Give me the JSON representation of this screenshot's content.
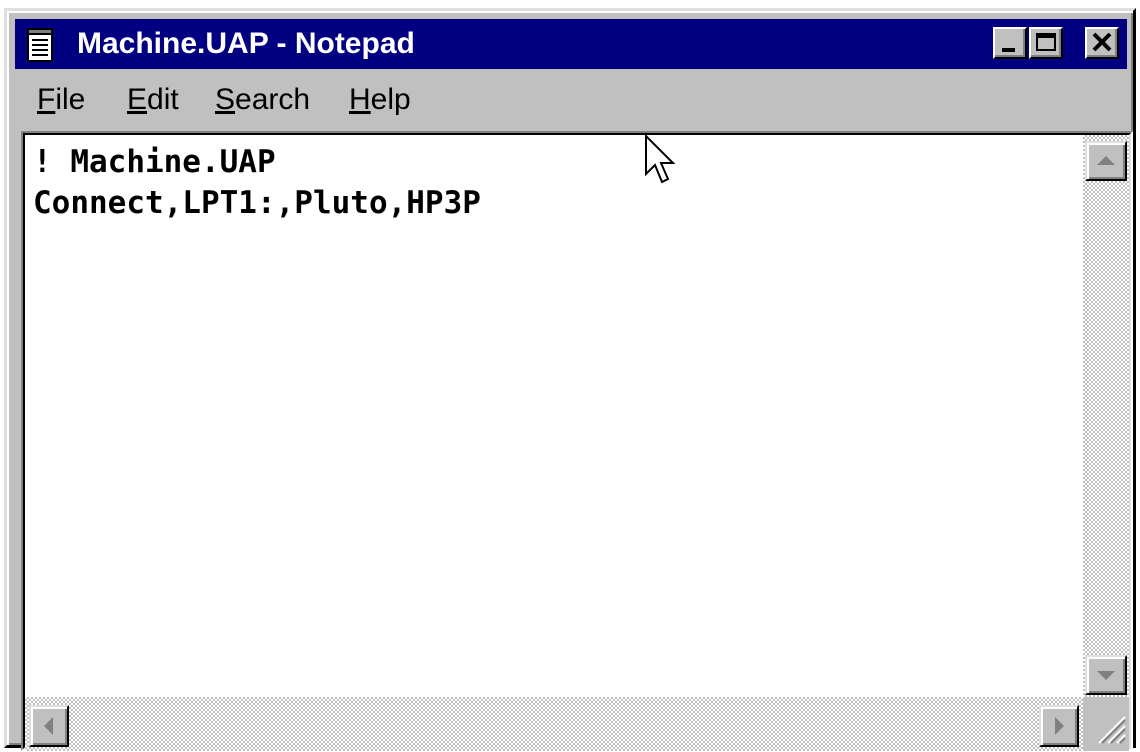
{
  "window": {
    "title": "Machine.UAP - Notepad",
    "title_bar_color": "#000080",
    "face_color": "#c0c0c0",
    "controls": {
      "minimize_icon": "minimize-icon",
      "maximize_icon": "maximize-icon",
      "close_icon": "close-icon"
    }
  },
  "menu": {
    "file": "File",
    "edit": "Edit",
    "search": "Search",
    "help": "Help"
  },
  "editor": {
    "lines": [
      "! Machine.UAP",
      "Connect,LPT1:,Pluto,HP3P"
    ]
  },
  "scrollbars": {
    "up_icon": "arrow-up-icon",
    "down_icon": "arrow-down-icon",
    "left_icon": "arrow-left-icon",
    "right_icon": "arrow-right-icon"
  }
}
